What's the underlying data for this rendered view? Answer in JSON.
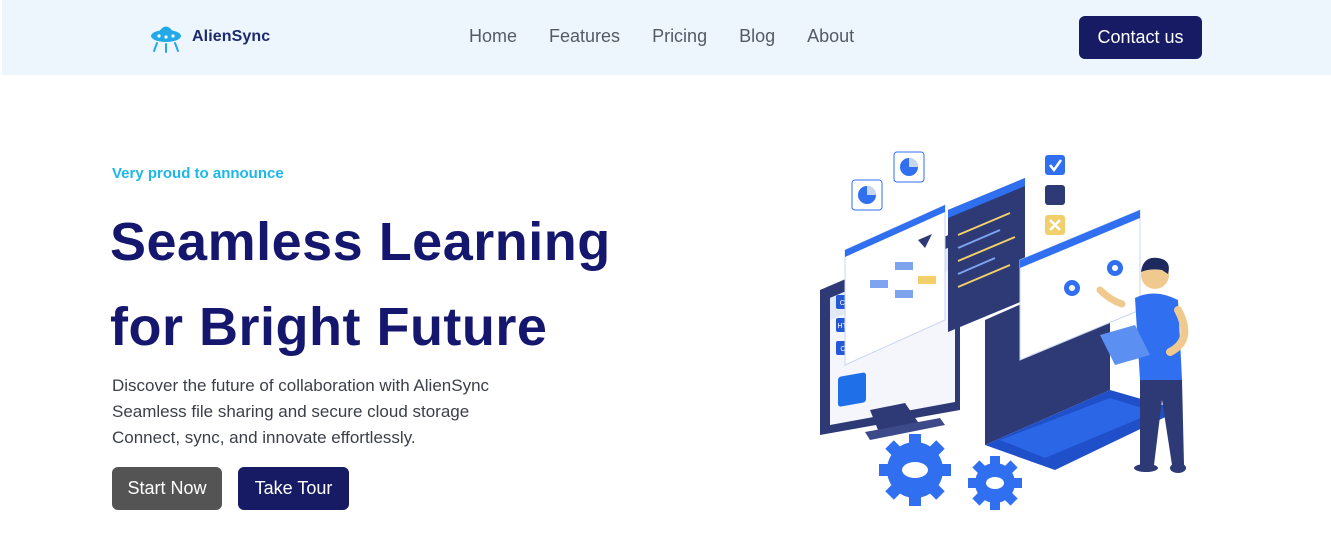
{
  "brand": {
    "name": "AlienSync",
    "logo_icon": "ufo-icon",
    "primary_color": "#15176e",
    "accent_color": "#1fb6ea"
  },
  "nav": {
    "links": [
      {
        "label": "Home"
      },
      {
        "label": "Features"
      },
      {
        "label": "Pricing"
      },
      {
        "label": "Blog"
      },
      {
        "label": "About"
      }
    ],
    "contact_label": "Contact us"
  },
  "hero": {
    "eyebrow": "Very proud to announce",
    "headline_line1": "Seamless Learning",
    "headline_line2": "for Bright Future",
    "description": [
      "Discover the future of collaboration with AlienSync",
      "Seamless file sharing and secure cloud storage",
      "Connect, sync, and innovate effortlessly."
    ],
    "primary_button": "Start Now",
    "secondary_button": "Take Tour",
    "illustration_code_tags": [
      "CSS",
      "HTML",
      "C++"
    ]
  }
}
